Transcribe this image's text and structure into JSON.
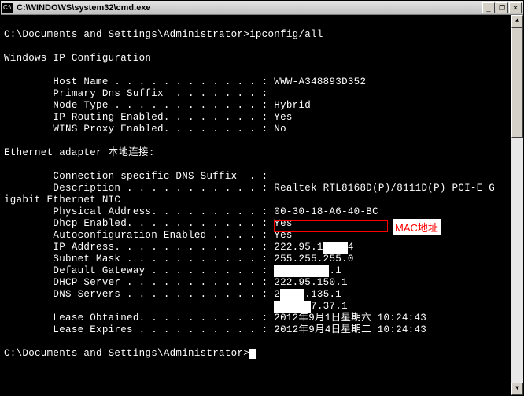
{
  "window": {
    "icon_text": "C:\\",
    "title": "C:\\WINDOWS\\system32\\cmd.exe",
    "min_label": "_",
    "max_label": "❐",
    "close_label": "✕"
  },
  "prompt": {
    "path": "C:\\Documents and Settings\\Administrator>",
    "command": "ipconfig/all"
  },
  "output": {
    "header": "Windows IP Configuration",
    "host_name_label": "        Host Name . . . . . . . . . . . . : ",
    "host_name_value": "WWW-A348893D352",
    "primary_dns_label": "        Primary Dns Suffix  . . . . . . . :",
    "node_type_label": "        Node Type . . . . . . . . . . . . : ",
    "node_type_value": "Hybrid",
    "ip_routing_label": "        IP Routing Enabled. . . . . . . . : ",
    "ip_routing_value": "Yes",
    "wins_proxy_label": "        WINS Proxy Enabled. . . . . . . . : ",
    "wins_proxy_value": "No",
    "adapter_header": "Ethernet adapter 本地连接:",
    "conn_dns_label": "        Connection-specific DNS Suffix  . :",
    "description_label": "        Description . . . . . . . . . . . : ",
    "description_value": "Realtek RTL8168D(P)/8111D(P) PCI-E G",
    "description_wrap": "igabit Ethernet NIC",
    "phys_addr_label": "        Physical Address. . . . . . . . . : ",
    "phys_addr_value": "00-30-18-A6-40-BC",
    "dhcp_enabled_label": "        Dhcp Enabled. . . . . . . . . . . : ",
    "dhcp_enabled_value": "Yes",
    "autoconfig_label": "        Autoconfiguration Enabled . . . . : ",
    "autoconfig_value": "Yes",
    "ip_address_label": "        IP Address. . . . . . . . . . . . : ",
    "ip_address_value_a": "222.95.1",
    "ip_address_redact": "  . ",
    "ip_address_value_b": "4",
    "subnet_label": "        Subnet Mask . . . . . . . . . . . : ",
    "subnet_value": "255.255.255.0",
    "gateway_label": "        Default Gateway . . . . . . . . . : ",
    "gateway_redact_a": "   .  .  ",
    "gateway_value_b": ".1",
    "dhcp_server_label": "        DHCP Server . . . . . . . . . . . : ",
    "dhcp_server_value": "222.95.150.1",
    "dns_servers_label": "        DNS Servers . . . . . . . . . . . : ",
    "dns_servers_value_a": "2",
    "dns_servers_redact_a": "  . ",
    "dns_servers_value_b": ".135.1",
    "dns_servers_line2_pad": "                                            ",
    "dns_servers_redact_b": "      ",
    "dns_servers_value_c": "7.37.1",
    "lease_obt_label": "        Lease Obtained. . . . . . . . . . : ",
    "lease_obt_value": "2012年9月1日星期六 10:24:43",
    "lease_exp_label": "        Lease Expires . . . . . . . . . . : ",
    "lease_exp_value": "2012年9月4日星期二 10:24:43"
  },
  "annotation": {
    "label": "MAC地址"
  },
  "scrollbar": {
    "up": "▲",
    "down": "▼"
  }
}
